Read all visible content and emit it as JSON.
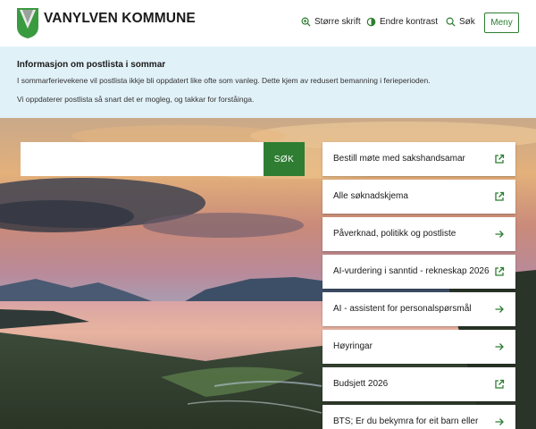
{
  "header": {
    "brand": "VANYLVEN KOMMUNE",
    "tools": {
      "bigger_text": "Større skrift",
      "contrast": "Endre kontrast",
      "search": "Søk"
    },
    "menu_label": "Meny"
  },
  "banner": {
    "title": "Informasjon om postlista i sommar",
    "line1": "I sommarferievekene vil postlista ikkje bli oppdatert like ofte som vanleg. Dette kjem av redusert bemanning i ferieperioden.",
    "line2": "Vi oppdaterer postlista så snart det er mogleg, og takkar for forståinga."
  },
  "search": {
    "placeholder": "",
    "button_label": "SØK"
  },
  "quick_links": [
    {
      "label": "Bestill møte med sakshandsamar",
      "icon": "external-link-icon"
    },
    {
      "label": "Alle søknadskjema",
      "icon": "external-link-icon"
    },
    {
      "label": "Påverknad, politikk og postliste",
      "icon": "arrow-right-icon"
    },
    {
      "label": "AI-vurdering i sanntid - rekneskap 2026",
      "icon": "external-link-icon"
    },
    {
      "label": "AI - assistent for personalspørsmål",
      "icon": "arrow-right-icon"
    },
    {
      "label": "Høyringar",
      "icon": "arrow-right-icon"
    },
    {
      "label": "Budsjett 2026",
      "icon": "external-link-icon"
    },
    {
      "label": "BTS; Er du bekymra for eit barn eller",
      "icon": "arrow-right-icon"
    }
  ],
  "colors": {
    "accent_green": "#2e7d32",
    "banner_bg": "#e1f1f8"
  }
}
